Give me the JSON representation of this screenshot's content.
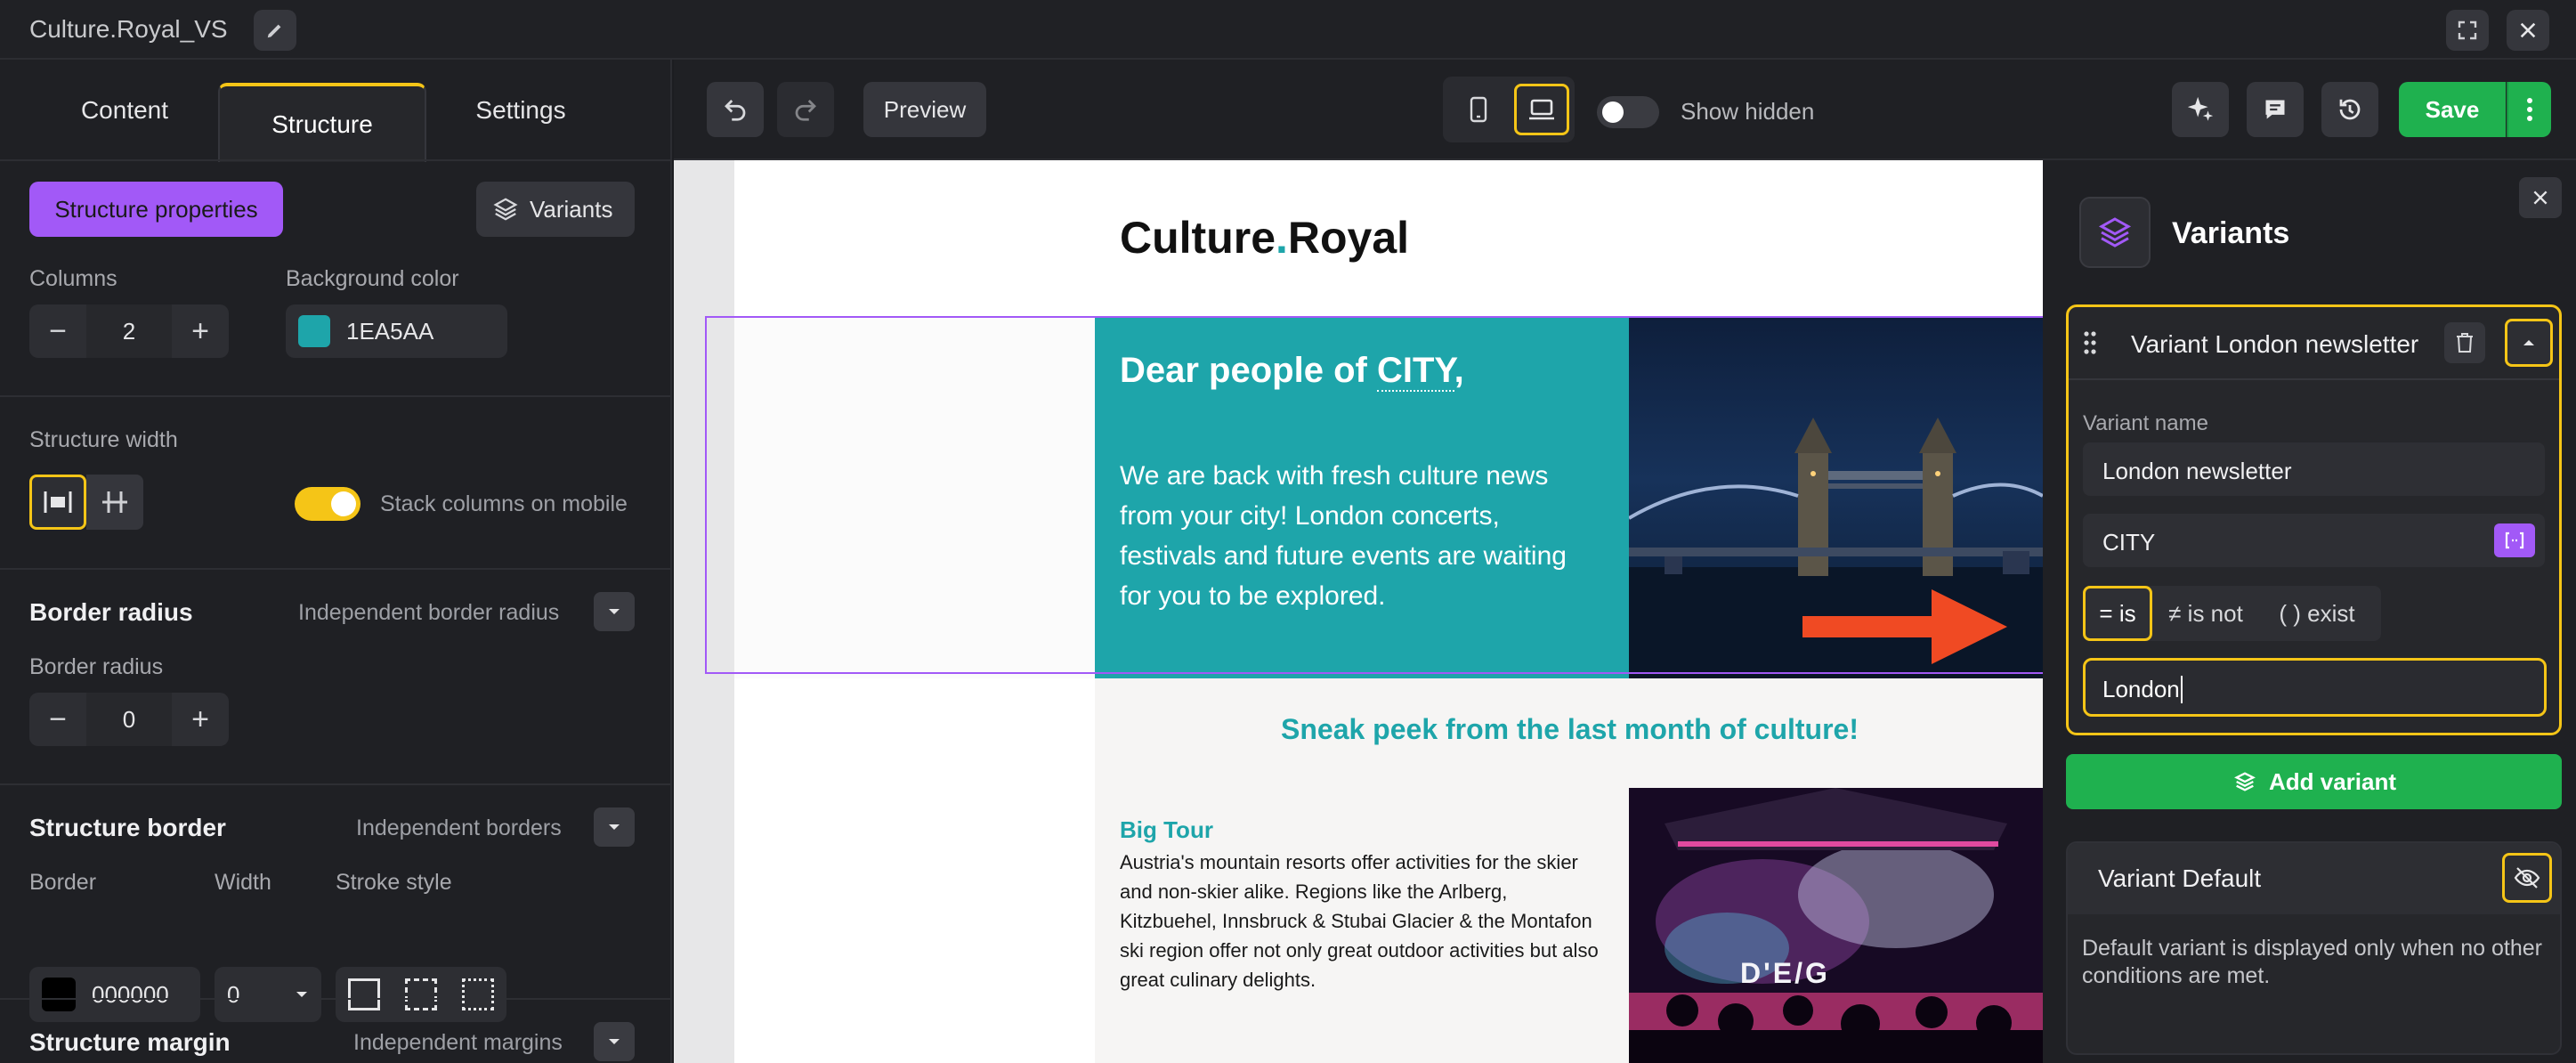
{
  "window": {
    "title": "Culture.Royal_VS",
    "edit_icon": "pencil-icon",
    "fullscreen_icon": "fullscreen-icon",
    "close_icon": "close-icon"
  },
  "left_tabs": [
    {
      "label": "Content"
    },
    {
      "label": "Structure"
    },
    {
      "label": "Settings"
    }
  ],
  "active_tab": "Structure",
  "structure": {
    "properties_label": "Structure properties",
    "variants_label": "Variants",
    "columns_label": "Columns",
    "columns_value": "2",
    "bg_color_label": "Background color",
    "bg_color_value": "1EA5AA",
    "bg_color_hex": "#1EA5AA",
    "width_label": "Structure width",
    "stack_label": "Stack columns on mobile",
    "stack_on": true,
    "border_radius_title": "Border radius",
    "independent_radius": "Independent border radius",
    "border_radius_label": "Border radius",
    "border_radius_value": "0",
    "border_title": "Structure border",
    "independent_borders": "Independent borders",
    "border_label": "Border",
    "width_col_label": "Width",
    "stroke_label": "Stroke style",
    "border_color": "000000",
    "border_width": "0",
    "margin_title": "Structure margin",
    "independent_margins": "Independent margins"
  },
  "toolbar": {
    "preview_label": "Preview",
    "show_hidden_label": "Show hidden",
    "save_label": "Save",
    "icons": [
      "undo-icon",
      "redo-icon",
      "mobile-icon",
      "desktop-icon",
      "sparkle-icon",
      "comment-icon",
      "history-icon",
      "more-icon"
    ]
  },
  "email": {
    "logo_left": "Culture",
    "logo_dot": ".",
    "logo_right": "Royal",
    "headline_pre": "Dear people of ",
    "headline_var": "CITY",
    "headline_post": ",",
    "body": "We are back with fresh culture news from your city! London concerts, festivals and future events are waiting for you to be explored.",
    "sneak_peek": "Sneak peek from the last month of culture!",
    "article_title": "Big Tour",
    "article_body": "Austria's mountain resorts offer activities for the skier and non-skier alike. Regions like the Arlberg, Kitzbuehel, Innsbruck & Stubai Glacier & the Montafon ski region offer not only great outdoor activities but also great culinary delights.",
    "stage_text": "D'E/G",
    "accent": "#1EA5AA"
  },
  "variants_panel": {
    "title": "Variants",
    "variant_title": "Variant London newsletter",
    "name_label": "Variant name",
    "name_value": "London newsletter",
    "condition_var": "CITY",
    "op_is": "= is",
    "op_is_not": "≠ is not",
    "op_exist": "( ) exist",
    "condition_value": "London",
    "add_label": "Add variant",
    "default_title": "Variant Default",
    "default_desc": "Default variant is displayed only when no other conditions are met."
  },
  "colors": {
    "save_green": "#1fb14f",
    "purple": "#a259f7",
    "yellow": "#f5c517",
    "arrow": "#f04a23"
  }
}
